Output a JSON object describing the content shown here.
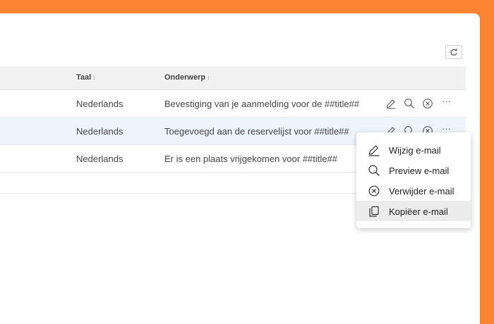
{
  "table": {
    "columns": [
      {
        "label": "Taal",
        "sort": "↕"
      },
      {
        "label": "Onderwerp",
        "sort": "↕"
      }
    ],
    "rows": [
      {
        "language": "Nederlands",
        "subject": "Bevestiging van je aanmelding voor de ##title##"
      },
      {
        "language": "Nederlands",
        "subject": "Toegevoegd aan de reservelijst voor ##title##"
      },
      {
        "language": "Nederlands",
        "subject": "Er is een plaats vrijgekomen voor ##title##"
      }
    ],
    "more_label": "···"
  },
  "menu": {
    "items": [
      {
        "label": "Wijzig e-mail",
        "icon": "pencil-icon"
      },
      {
        "label": "Preview e-mail",
        "icon": "search-icon"
      },
      {
        "label": "Verwijder e-mail",
        "icon": "close-circle-icon"
      },
      {
        "label": "Kopiëer e-mail",
        "icon": "copy-icon"
      }
    ]
  },
  "colors": {
    "frame": "#fd8431",
    "highlight_row": "#eef4fb",
    "menu_active": "#ececec"
  }
}
